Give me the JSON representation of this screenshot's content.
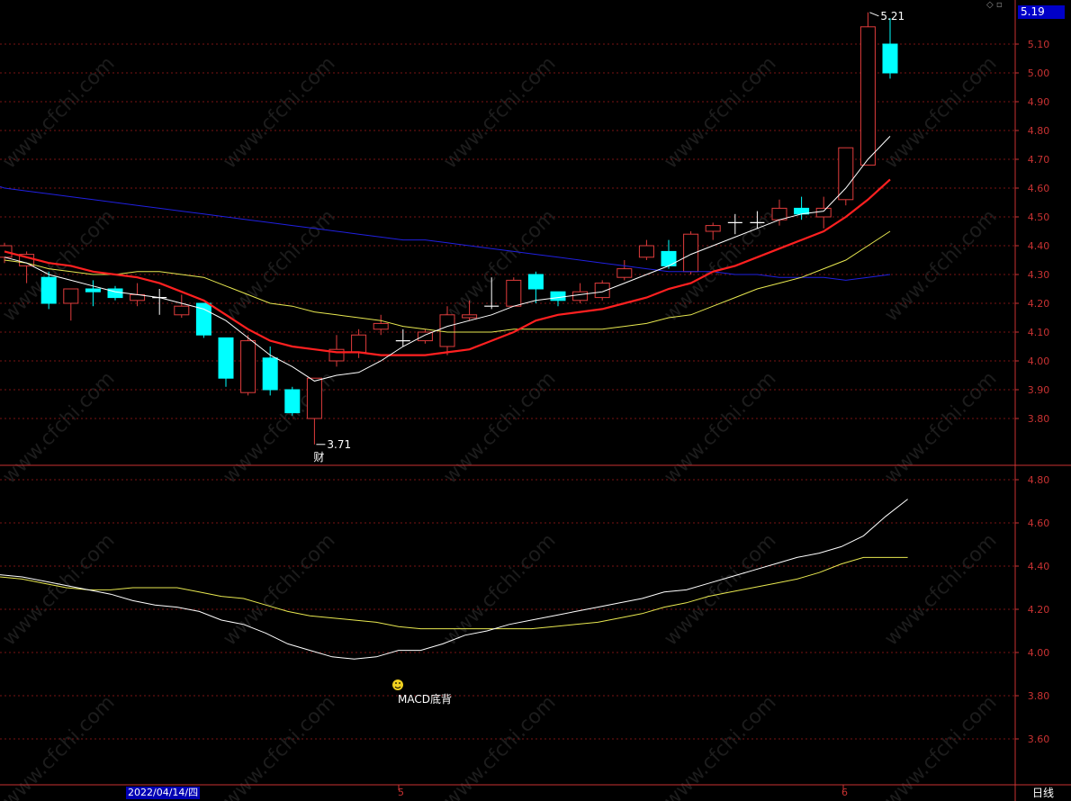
{
  "watermark": "www.cfchi.com",
  "current_price_label": "5.19",
  "period_label": "日线",
  "date_label": "2022/04/14/四",
  "month_labels": [
    "5",
    "6"
  ],
  "annotations": {
    "low_label": "3.71",
    "high_label": "5.21",
    "finance_mark": "财",
    "macd_signal": "MACD底背"
  },
  "colors": {
    "background": "#000000",
    "up": "#e03c3c",
    "down": "#00ffff",
    "axis": "#c83232",
    "ma_fast": "#ffffff",
    "ma_mid": "#ff2020",
    "ma_slow": "#e8e850",
    "ma_long": "#2020e0"
  },
  "chart_data": [
    {
      "type": "candlestick",
      "name": "price",
      "ylim": [
        3.7,
        5.21
      ],
      "yticks": [
        "5.10",
        "5.00",
        "4.90",
        "4.80",
        "4.70",
        "4.60",
        "4.50",
        "4.40",
        "4.30",
        "4.20",
        "4.10",
        "4.00",
        "3.90",
        "3.80"
      ],
      "grid": true,
      "candles": [
        [
          4.36,
          4.4,
          4.41,
          4.34
        ],
        [
          4.33,
          4.37,
          4.38,
          4.27
        ],
        [
          4.29,
          4.2,
          4.31,
          4.18
        ],
        [
          4.2,
          4.25,
          4.25,
          4.14
        ],
        [
          4.25,
          4.24,
          4.28,
          4.19
        ],
        [
          4.25,
          4.22,
          4.26,
          4.21
        ],
        [
          4.21,
          4.23,
          4.27,
          4.19
        ],
        [
          4.22,
          4.22,
          4.25,
          4.16
        ],
        [
          4.16,
          4.19,
          4.23,
          4.15
        ],
        [
          4.2,
          4.09,
          4.2,
          4.08
        ],
        [
          4.08,
          3.94,
          4.08,
          3.91
        ],
        [
          3.89,
          4.07,
          4.09,
          3.88
        ],
        [
          4.01,
          3.9,
          4.05,
          3.88
        ],
        [
          3.9,
          3.82,
          3.91,
          3.81
        ],
        [
          3.8,
          3.94,
          3.94,
          3.71
        ],
        [
          4.0,
          4.04,
          4.09,
          3.98
        ],
        [
          4.03,
          4.09,
          4.11,
          4.01
        ],
        [
          4.11,
          4.13,
          4.16,
          4.09
        ],
        [
          4.07,
          4.07,
          4.11,
          4.05
        ],
        [
          4.07,
          4.1,
          4.11,
          4.06
        ],
        [
          4.05,
          4.16,
          4.19,
          4.02
        ],
        [
          4.15,
          4.16,
          4.21,
          4.14
        ],
        [
          4.19,
          4.19,
          4.29,
          4.18
        ],
        [
          4.19,
          4.28,
          4.29,
          4.19
        ],
        [
          4.3,
          4.25,
          4.31,
          4.2
        ],
        [
          4.24,
          4.21,
          4.24,
          4.19
        ],
        [
          4.21,
          4.24,
          4.27,
          4.2
        ],
        [
          4.22,
          4.27,
          4.28,
          4.21
        ],
        [
          4.29,
          4.32,
          4.35,
          4.28
        ],
        [
          4.36,
          4.4,
          4.42,
          4.35
        ],
        [
          4.38,
          4.33,
          4.42,
          4.32
        ],
        [
          4.31,
          4.44,
          4.45,
          4.3
        ],
        [
          4.45,
          4.47,
          4.48,
          4.42
        ],
        [
          4.48,
          4.48,
          4.51,
          4.44
        ],
        [
          4.48,
          4.48,
          4.52,
          4.46
        ],
        [
          4.49,
          4.53,
          4.56,
          4.47
        ],
        [
          4.53,
          4.51,
          4.57,
          4.49
        ],
        [
          4.5,
          4.53,
          4.57,
          4.46
        ],
        [
          4.56,
          4.74,
          4.74,
          4.54
        ],
        [
          4.68,
          5.16,
          5.21,
          4.68
        ],
        [
          5.1,
          5.0,
          5.19,
          4.98
        ]
      ],
      "ma_fast": [
        4.36,
        4.34,
        4.3,
        4.28,
        4.26,
        4.24,
        4.23,
        4.22,
        4.2,
        4.18,
        4.14,
        4.08,
        4.02,
        3.98,
        3.93,
        3.95,
        3.96,
        4.0,
        4.05,
        4.09,
        4.12,
        4.14,
        4.16,
        4.19,
        4.21,
        4.22,
        4.23,
        4.24,
        4.27,
        4.3,
        4.33,
        4.37,
        4.4,
        4.43,
        4.46,
        4.49,
        4.51,
        4.52,
        4.6,
        4.7,
        4.78
      ],
      "ma_mid": [
        4.38,
        4.36,
        4.34,
        4.33,
        4.31,
        4.3,
        4.29,
        4.27,
        4.24,
        4.21,
        4.16,
        4.11,
        4.07,
        4.05,
        4.04,
        4.03,
        4.03,
        4.02,
        4.02,
        4.02,
        4.03,
        4.04,
        4.07,
        4.1,
        4.14,
        4.16,
        4.17,
        4.18,
        4.2,
        4.22,
        4.25,
        4.27,
        4.31,
        4.33,
        4.36,
        4.39,
        4.42,
        4.45,
        4.5,
        4.56,
        4.63
      ],
      "ma_slow": [
        4.35,
        4.34,
        4.32,
        4.31,
        4.3,
        4.3,
        4.31,
        4.31,
        4.3,
        4.29,
        4.26,
        4.23,
        4.2,
        4.19,
        4.17,
        4.16,
        4.15,
        4.14,
        4.12,
        4.11,
        4.1,
        4.1,
        4.1,
        4.11,
        4.11,
        4.11,
        4.11,
        4.11,
        4.12,
        4.13,
        4.15,
        4.16,
        4.19,
        4.22,
        4.25,
        4.27,
        4.29,
        4.32,
        4.35,
        4.4,
        4.45
      ],
      "ma_long": [
        4.6,
        4.59,
        4.58,
        4.57,
        4.56,
        4.55,
        4.54,
        4.53,
        4.52,
        4.51,
        4.5,
        4.49,
        4.48,
        4.47,
        4.46,
        4.45,
        4.44,
        4.43,
        4.42,
        4.42,
        4.41,
        4.4,
        4.39,
        4.38,
        4.37,
        4.36,
        4.35,
        4.34,
        4.33,
        4.32,
        4.31,
        4.31,
        4.31,
        4.3,
        4.3,
        4.29,
        4.29,
        4.29,
        4.28,
        4.29,
        4.3
      ]
    },
    {
      "type": "line",
      "name": "indicator",
      "ylim": [
        3.5,
        4.9
      ],
      "yticks": [
        "4.80",
        "4.60",
        "4.40",
        "4.20",
        "4.00",
        "3.80",
        "3.60"
      ],
      "grid": true,
      "line_white": [
        4.36,
        4.35,
        4.33,
        4.31,
        4.29,
        4.27,
        4.24,
        4.22,
        4.21,
        4.19,
        4.15,
        4.13,
        4.09,
        4.04,
        4.01,
        3.98,
        3.97,
        3.98,
        4.01,
        4.01,
        4.04,
        4.08,
        4.1,
        4.13,
        4.15,
        4.17,
        4.19,
        4.21,
        4.23,
        4.25,
        4.28,
        4.29,
        4.32,
        4.35,
        4.38,
        4.41,
        4.44,
        4.46,
        4.49,
        4.54,
        4.63,
        4.71
      ],
      "line_yellow": [
        4.35,
        4.34,
        4.32,
        4.3,
        4.29,
        4.29,
        4.3,
        4.3,
        4.3,
        4.28,
        4.26,
        4.25,
        4.22,
        4.19,
        4.17,
        4.16,
        4.15,
        4.14,
        4.12,
        4.11,
        4.11,
        4.11,
        4.11,
        4.11,
        4.11,
        4.12,
        4.13,
        4.14,
        4.16,
        4.18,
        4.21,
        4.23,
        4.26,
        4.28,
        4.3,
        4.32,
        4.34,
        4.37,
        4.41,
        4.44,
        4.44,
        4.44
      ]
    }
  ]
}
